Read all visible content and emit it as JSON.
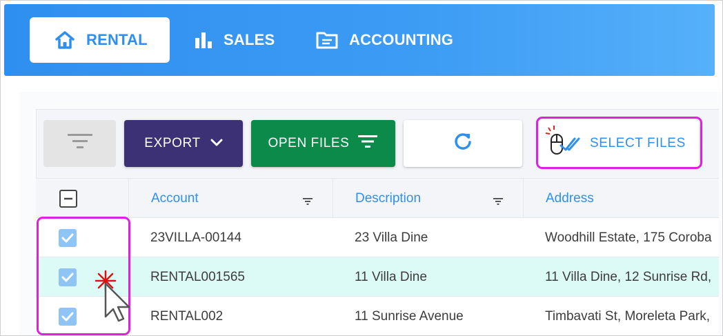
{
  "nav": {
    "tabs": [
      {
        "label": "RENTAL",
        "icon": "home-icon",
        "active": true
      },
      {
        "label": "SALES",
        "icon": "bar-chart-icon",
        "active": false
      },
      {
        "label": "ACCOUNTING",
        "icon": "folder-icon",
        "active": false
      }
    ]
  },
  "toolbar": {
    "filter_icon": "filter-icon",
    "export_label": "EXPORT",
    "open_files_label": "OPEN FILES",
    "refresh_icon": "refresh-icon",
    "select_files_label": "SELECT FILES"
  },
  "table": {
    "columns": [
      {
        "label": "Account"
      },
      {
        "label": "Description"
      },
      {
        "label": "Address"
      }
    ],
    "rows": [
      {
        "checked": true,
        "selected": false,
        "account": "23VILLA-00144",
        "description": "23 Villa Dine",
        "address": "Woodhill Estate, 175 Coroba"
      },
      {
        "checked": true,
        "selected": true,
        "account": "RENTAL001565",
        "description": "11 Villa Dine",
        "address": "11 Villa Dine, 12 Sunrise Rd,"
      },
      {
        "checked": true,
        "selected": false,
        "account": "RENTAL002",
        "description": "11 Sunrise Avenue",
        "address": "Timbavati St, Moreleta Park,"
      }
    ]
  },
  "colors": {
    "nav_bg": "#3d9cf4",
    "accent": "#2f8ff0",
    "export_bg": "#3d3176",
    "open_files_bg": "#0b8a4a",
    "highlight": "#e020e0",
    "selected_row": "#dcfaf6"
  }
}
